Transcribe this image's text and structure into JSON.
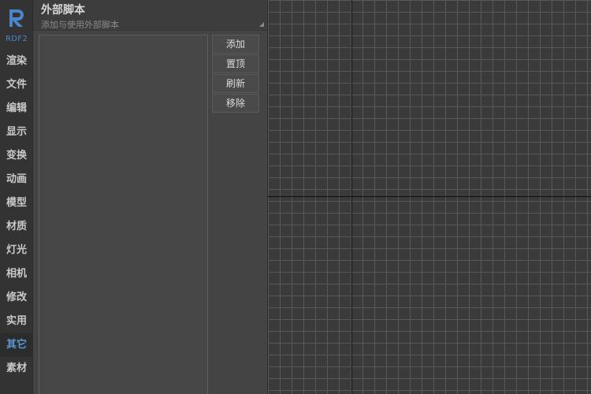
{
  "sidebar": {
    "logo_text": "RDF2",
    "items": [
      {
        "label": "渲染"
      },
      {
        "label": "文件"
      },
      {
        "label": "编辑"
      },
      {
        "label": "显示"
      },
      {
        "label": "变换"
      },
      {
        "label": "动画"
      },
      {
        "label": "模型"
      },
      {
        "label": "材质"
      },
      {
        "label": "灯光"
      },
      {
        "label": "相机"
      },
      {
        "label": "修改"
      },
      {
        "label": "实用"
      },
      {
        "label": "其它"
      },
      {
        "label": "素材"
      }
    ],
    "active_item": "其它",
    "accent_color": "#5b96d6"
  },
  "panel": {
    "title": "外部脚本",
    "subtitle": "添加与使用外部脚本",
    "buttons": {
      "add": "添加",
      "top": "置顶",
      "refresh": "刷新",
      "remove": "移除"
    }
  },
  "viewport": {
    "background_color": "#3a3a3a",
    "grid_color": "#585858",
    "axis_color": "#111111"
  }
}
